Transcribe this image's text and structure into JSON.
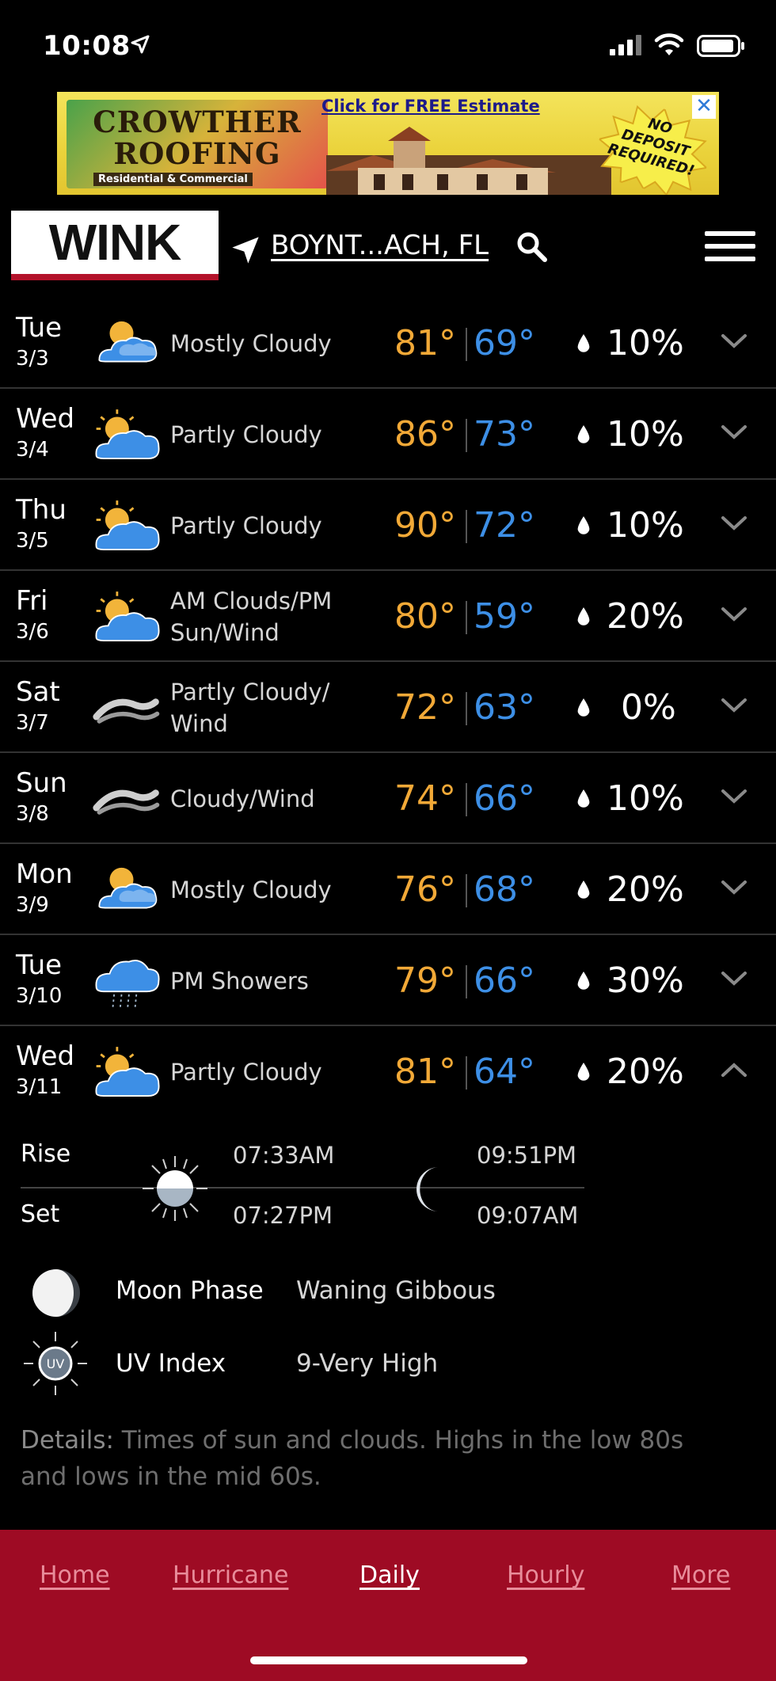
{
  "status_bar": {
    "time": "10:08"
  },
  "ad": {
    "brand_line1": "CROWTHER",
    "brand_line2": "ROOFING",
    "brand_sub": "Residential & Commercial",
    "cta": "Click for FREE Estimate",
    "badge_line1": "NO",
    "badge_line2": "DEPOSIT",
    "badge_line3": "REQUIRED!",
    "close": "✕"
  },
  "header": {
    "logo": "WINK",
    "location": "BOYNT...ACH, FL"
  },
  "forecast": [
    {
      "day": "Tue",
      "date": "3/3",
      "icon": "mostly-cloudy-icon",
      "condition": "Mostly Cloudy",
      "high": "81°",
      "low": "69°",
      "precip": "10%",
      "expanded": false
    },
    {
      "day": "Wed",
      "date": "3/4",
      "icon": "partly-cloudy-icon",
      "condition": "Partly Cloudy",
      "high": "86°",
      "low": "73°",
      "precip": "10%",
      "expanded": false
    },
    {
      "day": "Thu",
      "date": "3/5",
      "icon": "partly-cloudy-icon",
      "condition": "Partly Cloudy",
      "high": "90°",
      "low": "72°",
      "precip": "10%",
      "expanded": false
    },
    {
      "day": "Fri",
      "date": "3/6",
      "icon": "partly-cloudy-icon",
      "condition": "AM Clouds/PM Sun/Wind",
      "high": "80°",
      "low": "59°",
      "precip": "20%",
      "expanded": false
    },
    {
      "day": "Sat",
      "date": "3/7",
      "icon": "wind-icon",
      "condition": "Partly Cloudy/ Wind",
      "high": "72°",
      "low": "63°",
      "precip": "0%",
      "expanded": false
    },
    {
      "day": "Sun",
      "date": "3/8",
      "icon": "wind-icon",
      "condition": "Cloudy/Wind",
      "high": "74°",
      "low": "66°",
      "precip": "10%",
      "expanded": false
    },
    {
      "day": "Mon",
      "date": "3/9",
      "icon": "mostly-cloudy-icon",
      "condition": "Mostly Cloudy",
      "high": "76°",
      "low": "68°",
      "precip": "20%",
      "expanded": false
    },
    {
      "day": "Tue",
      "date": "3/10",
      "icon": "showers-icon",
      "condition": "PM Showers",
      "high": "79°",
      "low": "66°",
      "precip": "30%",
      "expanded": false
    },
    {
      "day": "Wed",
      "date": "3/11",
      "icon": "partly-cloudy-icon",
      "condition": "Partly Cloudy",
      "high": "81°",
      "low": "64°",
      "precip": "20%",
      "expanded": true
    }
  ],
  "expanded_details": {
    "rise_label": "Rise",
    "set_label": "Set",
    "sunrise": "07:33AM",
    "sunset": "07:27PM",
    "moonrise": "09:51PM",
    "moonset": "09:07AM",
    "moon_phase_label": "Moon Phase",
    "moon_phase": "Waning Gibbous",
    "uv_label": "UV Index",
    "uv_icon_text": "UV",
    "uv_value": "9-Very High",
    "details_label": "Details:",
    "details_text": " Times of sun and clouds. Highs in the low 80s and lows in the mid 60s."
  },
  "tabs": [
    {
      "label": "Home",
      "active": false
    },
    {
      "label": "Hurricane",
      "active": false
    },
    {
      "label": "Daily",
      "active": true
    },
    {
      "label": "Hourly",
      "active": false
    },
    {
      "label": "More",
      "active": false
    }
  ],
  "colors": {
    "high": "#f2a937",
    "low": "#3d8fe6",
    "tab_bar": "#9e0b24",
    "logo_accent": "#b3122a"
  }
}
